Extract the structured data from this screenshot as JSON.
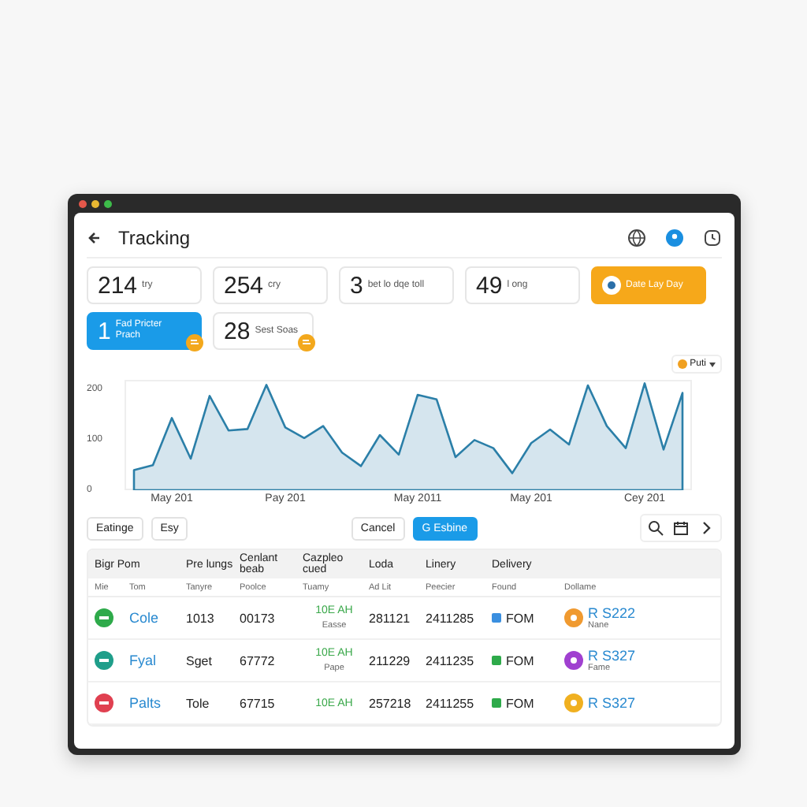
{
  "window": {
    "title": "Tracking"
  },
  "header_icons": [
    {
      "kind": "globe"
    },
    {
      "kind": "profile"
    },
    {
      "kind": "clock"
    }
  ],
  "stats": [
    {
      "kind": "plain",
      "value": "214",
      "label": "try"
    },
    {
      "kind": "plain",
      "value": "254",
      "label": "cry"
    },
    {
      "kind": "plain",
      "value": "3",
      "label": "bet lo dqe toll"
    },
    {
      "kind": "plain",
      "value": "49",
      "label": "l ong"
    },
    {
      "kind": "accent",
      "label": "Date Lay Day"
    },
    {
      "kind": "highlight",
      "value": "1",
      "label": "Fad Pricter Prach"
    },
    {
      "kind": "badge",
      "value": "28",
      "label": "Sest Soas"
    }
  ],
  "chart": {
    "legend": {
      "color": "#f0a020"
    },
    "chart_data": {
      "type": "area",
      "categories": [
        null,
        null,
        "May 201",
        null,
        null,
        null,
        null,
        null,
        "Pay 201",
        null,
        null,
        null,
        null,
        null,
        null,
        "May 2011",
        null,
        null,
        null,
        null,
        null,
        "May 201",
        null,
        null,
        null,
        null,
        null,
        "Cey 201",
        null,
        null
      ],
      "series": [
        {
          "name": "Puti",
          "color": "#2b7fa8",
          "values": [
            40,
            50,
            144,
            63,
            188,
            119,
            122,
            210,
            125,
            104,
            128,
            75,
            48,
            110,
            71,
            190,
            181,
            66,
            100,
            84,
            34,
            94,
            121,
            91,
            209,
            128,
            84,
            213,
            81,
            194
          ]
        }
      ],
      "ylim": [
        0,
        220
      ],
      "yticks": [
        0,
        100,
        200
      ]
    }
  },
  "toolbar": {
    "left": [
      "Eatinge",
      "Esy"
    ],
    "cancel": "Cancel",
    "primary": "G Esbine"
  },
  "table": {
    "group_headers": [
      "Bigr Pom",
      "Pre lungs",
      "Cenlant beab",
      "Cazpleo cued",
      "Loda",
      "Linery",
      "Delivery"
    ],
    "columns": [
      "Mie",
      "Tom",
      "Tanyre",
      "Poolce",
      "Tuamy",
      "Ad Lit",
      "Peecier",
      "Found",
      "Dollame"
    ],
    "rows": [
      {
        "icon": {
          "color": "#2eaa4a"
        },
        "name": "Cole",
        "c2": "1013",
        "c3": "00173",
        "time": "10E AH",
        "time_sub": "Easse",
        "c5": "281121",
        "c6": "2411285",
        "status": "FOM",
        "color": "#3a8fe0",
        "avatar": {
          "color": "#f09a30"
        },
        "ref": "R S222",
        "ref_sub": "Nane"
      },
      {
        "icon": {
          "color": "#1f9e8a"
        },
        "name": "Fyal",
        "c2": "Sget",
        "c3": "67772",
        "time": "10E AH",
        "time_sub": "Pape",
        "c5": "211229",
        "c6": "2411235",
        "status": "FOM",
        "color": "#2eaa4a",
        "avatar": {
          "color": "#a040d0"
        },
        "ref": "R S327",
        "ref_sub": "Fame"
      },
      {
        "icon": {
          "color": "#e04050"
        },
        "name": "Palts",
        "c2": "Tole",
        "c3": "67715",
        "time": "10E AH",
        "c5": "257218",
        "c6": "2411255",
        "status": "FOM",
        "color": "#2eaa4a",
        "avatar": {
          "color": "#f0b020"
        },
        "ref": "R S327"
      }
    ]
  }
}
